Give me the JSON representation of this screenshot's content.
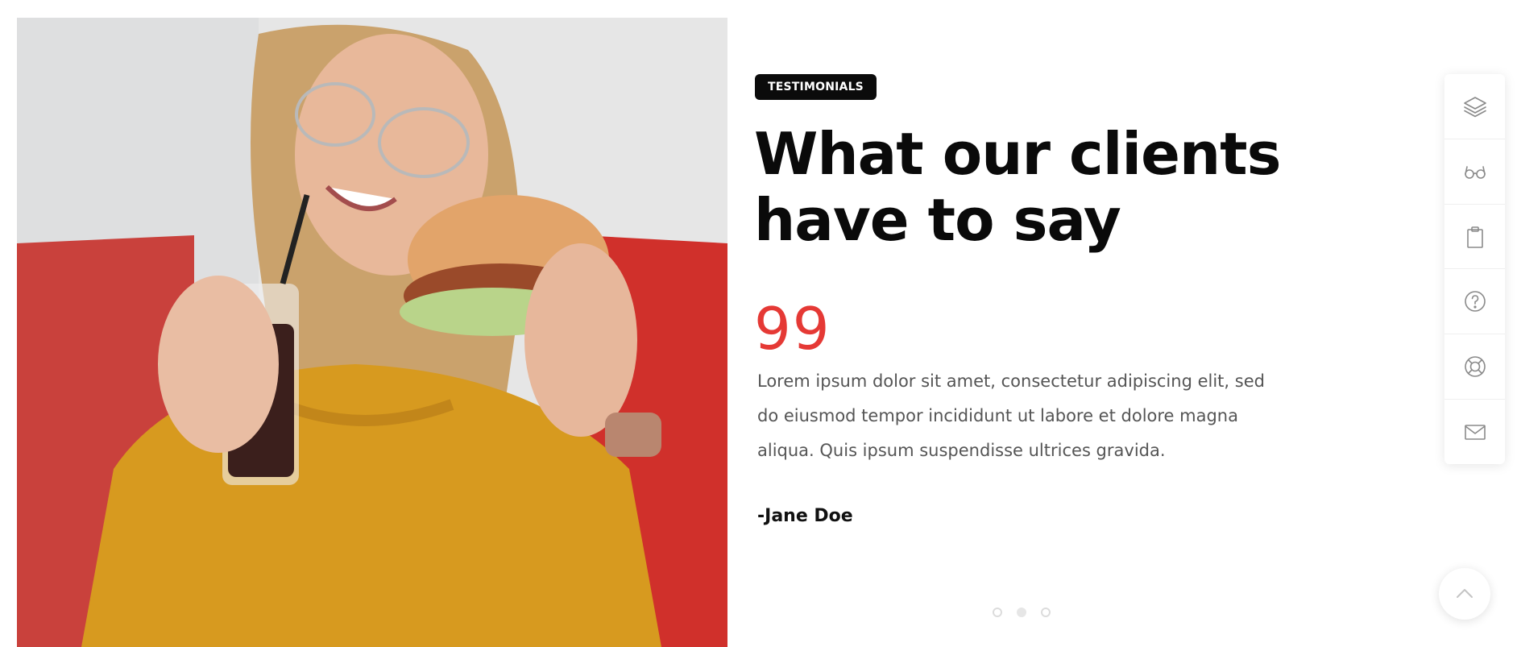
{
  "testimonial": {
    "badge": "TESTIMONIALS",
    "title": "What our clients have to say",
    "quote_mark": "99",
    "quote": "Lorem ipsum dolor sit amet, consectetur adipiscing elit, sed do eiusmod tempor incididunt ut labore et dolore magna aliqua. Quis ipsum suspendisse ultrices gravida.",
    "author": "-Jane Doe"
  },
  "slider": {
    "dots": 3,
    "active_index": 1
  },
  "toolbar": {
    "items": [
      "layers-icon",
      "glasses-icon",
      "clipboard-icon",
      "help-icon",
      "lifebuoy-icon",
      "mail-icon"
    ]
  },
  "colors": {
    "accent": "#e53935",
    "badge_bg": "#0b0b0b",
    "text_dark": "#0a0a0a",
    "text_muted": "#555555"
  }
}
